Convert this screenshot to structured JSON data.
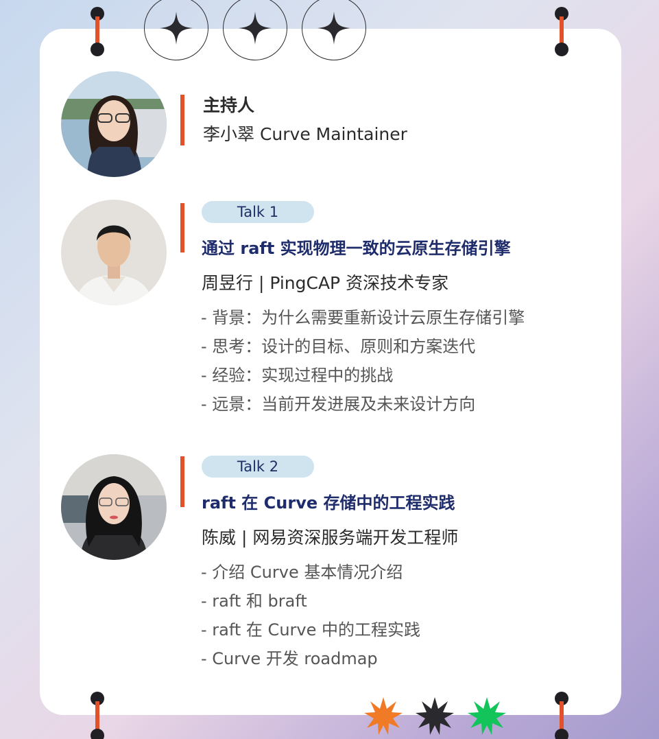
{
  "host": {
    "role": "主持人",
    "name": "李小翠 Curve Maintainer"
  },
  "talks": [
    {
      "label": "Talk 1",
      "title": "通过 raft 实现物理一致的云原生存储引擎",
      "speaker": "周昱行 | PingCAP 资深技术专家",
      "agenda": [
        "- 背景：为什么需要重新设计云原生存储引擎",
        "- 思考：设计的目标、原则和方案迭代",
        "- 经验：实现过程中的挑战",
        "- 远景：当前开发进展及未来设计方向"
      ]
    },
    {
      "label": "Talk 2",
      "title": "raft 在 Curve 存储中的工程实践",
      "speaker": "陈威 | 网易资深服务端开发工程师",
      "agenda": [
        "- 介绍 Curve 基本情况介绍",
        "- raft 和 braft",
        "- raft 在 Curve 中的工程实践",
        "- Curve 开发 roadmap"
      ]
    }
  ],
  "colors": {
    "accent": "#e2522a",
    "title": "#1e2c6b",
    "pill": "#cfe4ef",
    "star_orange": "#f07a26",
    "star_dark": "#2a2a2e",
    "star_green": "#12c45a"
  },
  "icons": [
    "sparkle-icon",
    "starburst-icon"
  ]
}
